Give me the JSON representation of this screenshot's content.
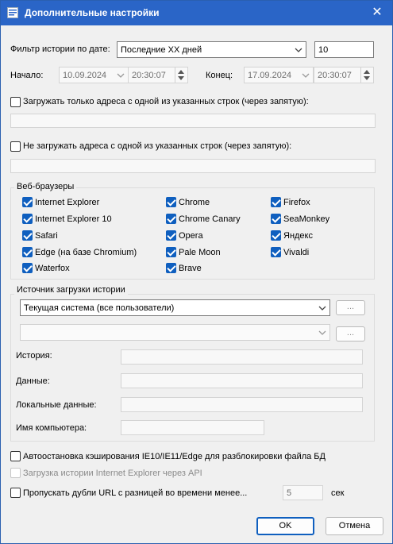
{
  "window": {
    "title": "Дополнительные настройки",
    "close_glyph": "✕",
    "icon": "app-icon"
  },
  "date_filter": {
    "label": "Фильтр истории по дате:",
    "mode": "Последние XX дней",
    "count": "10",
    "start_label": "Начало:",
    "start_date": "10.09.2024",
    "start_time": "20:30:07",
    "end_label": "Конец:",
    "end_date": "17.09.2024",
    "end_time": "20:30:07"
  },
  "include_urls": {
    "label": "Загружать только адреса с одной из указанных строк (через запятую):",
    "checked": false,
    "value": ""
  },
  "exclude_urls": {
    "label": "Не загружать адреса с одной из указанных строк (через запятую):",
    "checked": false,
    "value": ""
  },
  "browsers": {
    "title": "Веб-браузеры",
    "items": [
      {
        "label": "Internet Explorer",
        "checked": true
      },
      {
        "label": "Chrome",
        "checked": true
      },
      {
        "label": "Firefox",
        "checked": true
      },
      {
        "label": "Internet Explorer 10",
        "checked": true
      },
      {
        "label": "Chrome Canary",
        "checked": true
      },
      {
        "label": "SeaMonkey",
        "checked": true
      },
      {
        "label": "Safari",
        "checked": true
      },
      {
        "label": "Opera",
        "checked": true
      },
      {
        "label": "Яндекс",
        "checked": true
      },
      {
        "label": "Edge (на базе Chromium)",
        "checked": true
      },
      {
        "label": "Pale Moon",
        "checked": true
      },
      {
        "label": "Vivaldi",
        "checked": true
      },
      {
        "label": "Waterfox",
        "checked": true
      },
      {
        "label": "Brave",
        "checked": true
      }
    ]
  },
  "source": {
    "title": "Источник загрузки истории",
    "selected": "Текущая система (все пользователи)",
    "browse_label": "...",
    "second_value": "",
    "history_label": "История:",
    "data_label": "Данные:",
    "local_label": "Локальные данные:",
    "computer_label": "Имя компьютера:"
  },
  "options": {
    "autostop": {
      "label": "Автоостановка кэширования IE10/IE11/Edge для разблокировки файла БД",
      "checked": false
    },
    "ie_api": {
      "label": "Загрузка истории Internet Explorer через API",
      "checked": false,
      "disabled": true
    },
    "skip_dupes": {
      "label": "Пропускать дубли URL с разницей во времени менее...",
      "checked": false,
      "value": "5",
      "unit": "сек"
    }
  },
  "buttons": {
    "ok": "OK",
    "cancel": "Отмена"
  }
}
